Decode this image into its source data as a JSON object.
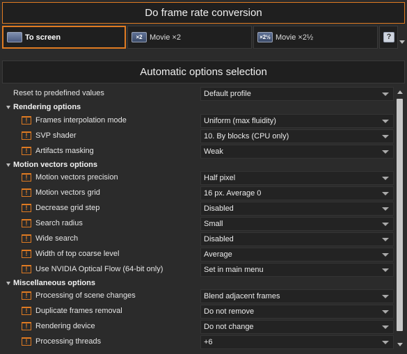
{
  "top_button": "Do frame rate conversion",
  "profiles": [
    {
      "label": "To screen",
      "icon": "screen",
      "active": true
    },
    {
      "label": "Movie ×2",
      "icon_text": "×2",
      "active": false
    },
    {
      "label": "Movie ×2½",
      "icon_text": "×2½",
      "active": false
    },
    {
      "label": "",
      "icon_text": "?",
      "active": false
    }
  ],
  "section_title": "Automatic options selection",
  "rows": [
    {
      "kind": "top",
      "label": "Reset to predefined values",
      "value": "Default profile"
    },
    {
      "kind": "group",
      "label": "Rendering options"
    },
    {
      "kind": "option",
      "label": "Frames interpolation mode",
      "value": "Uniform (max fluidity)"
    },
    {
      "kind": "option",
      "label": "SVP shader",
      "value": "10. By blocks (CPU only)"
    },
    {
      "kind": "option",
      "label": "Artifacts masking",
      "value": "Weak"
    },
    {
      "kind": "group",
      "label": "Motion vectors options"
    },
    {
      "kind": "option",
      "label": "Motion vectors precision",
      "value": "Half pixel"
    },
    {
      "kind": "option",
      "label": "Motion vectors grid",
      "value": "16 px. Average 0"
    },
    {
      "kind": "option",
      "label": "Decrease grid step",
      "value": "Disabled"
    },
    {
      "kind": "option",
      "label": "Search radius",
      "value": "Small"
    },
    {
      "kind": "option",
      "label": "Wide search",
      "value": "Disabled"
    },
    {
      "kind": "option",
      "label": "Width of top coarse level",
      "value": "Average"
    },
    {
      "kind": "option",
      "label": "Use NVIDIA Optical Flow (64-bit only)",
      "value": "Set in main menu"
    },
    {
      "kind": "group",
      "label": "Miscellaneous options"
    },
    {
      "kind": "option",
      "label": "Processing of scene changes",
      "value": "Blend adjacent frames"
    },
    {
      "kind": "option",
      "label": "Duplicate frames removal",
      "value": "Do not remove"
    },
    {
      "kind": "option",
      "label": "Rendering device",
      "value": "Do not change"
    },
    {
      "kind": "option",
      "label": "Processing threads",
      "value": "+6"
    }
  ],
  "warn_glyph": "!",
  "colors": {
    "accent": "#e07b22",
    "background": "#2b2b2b"
  }
}
